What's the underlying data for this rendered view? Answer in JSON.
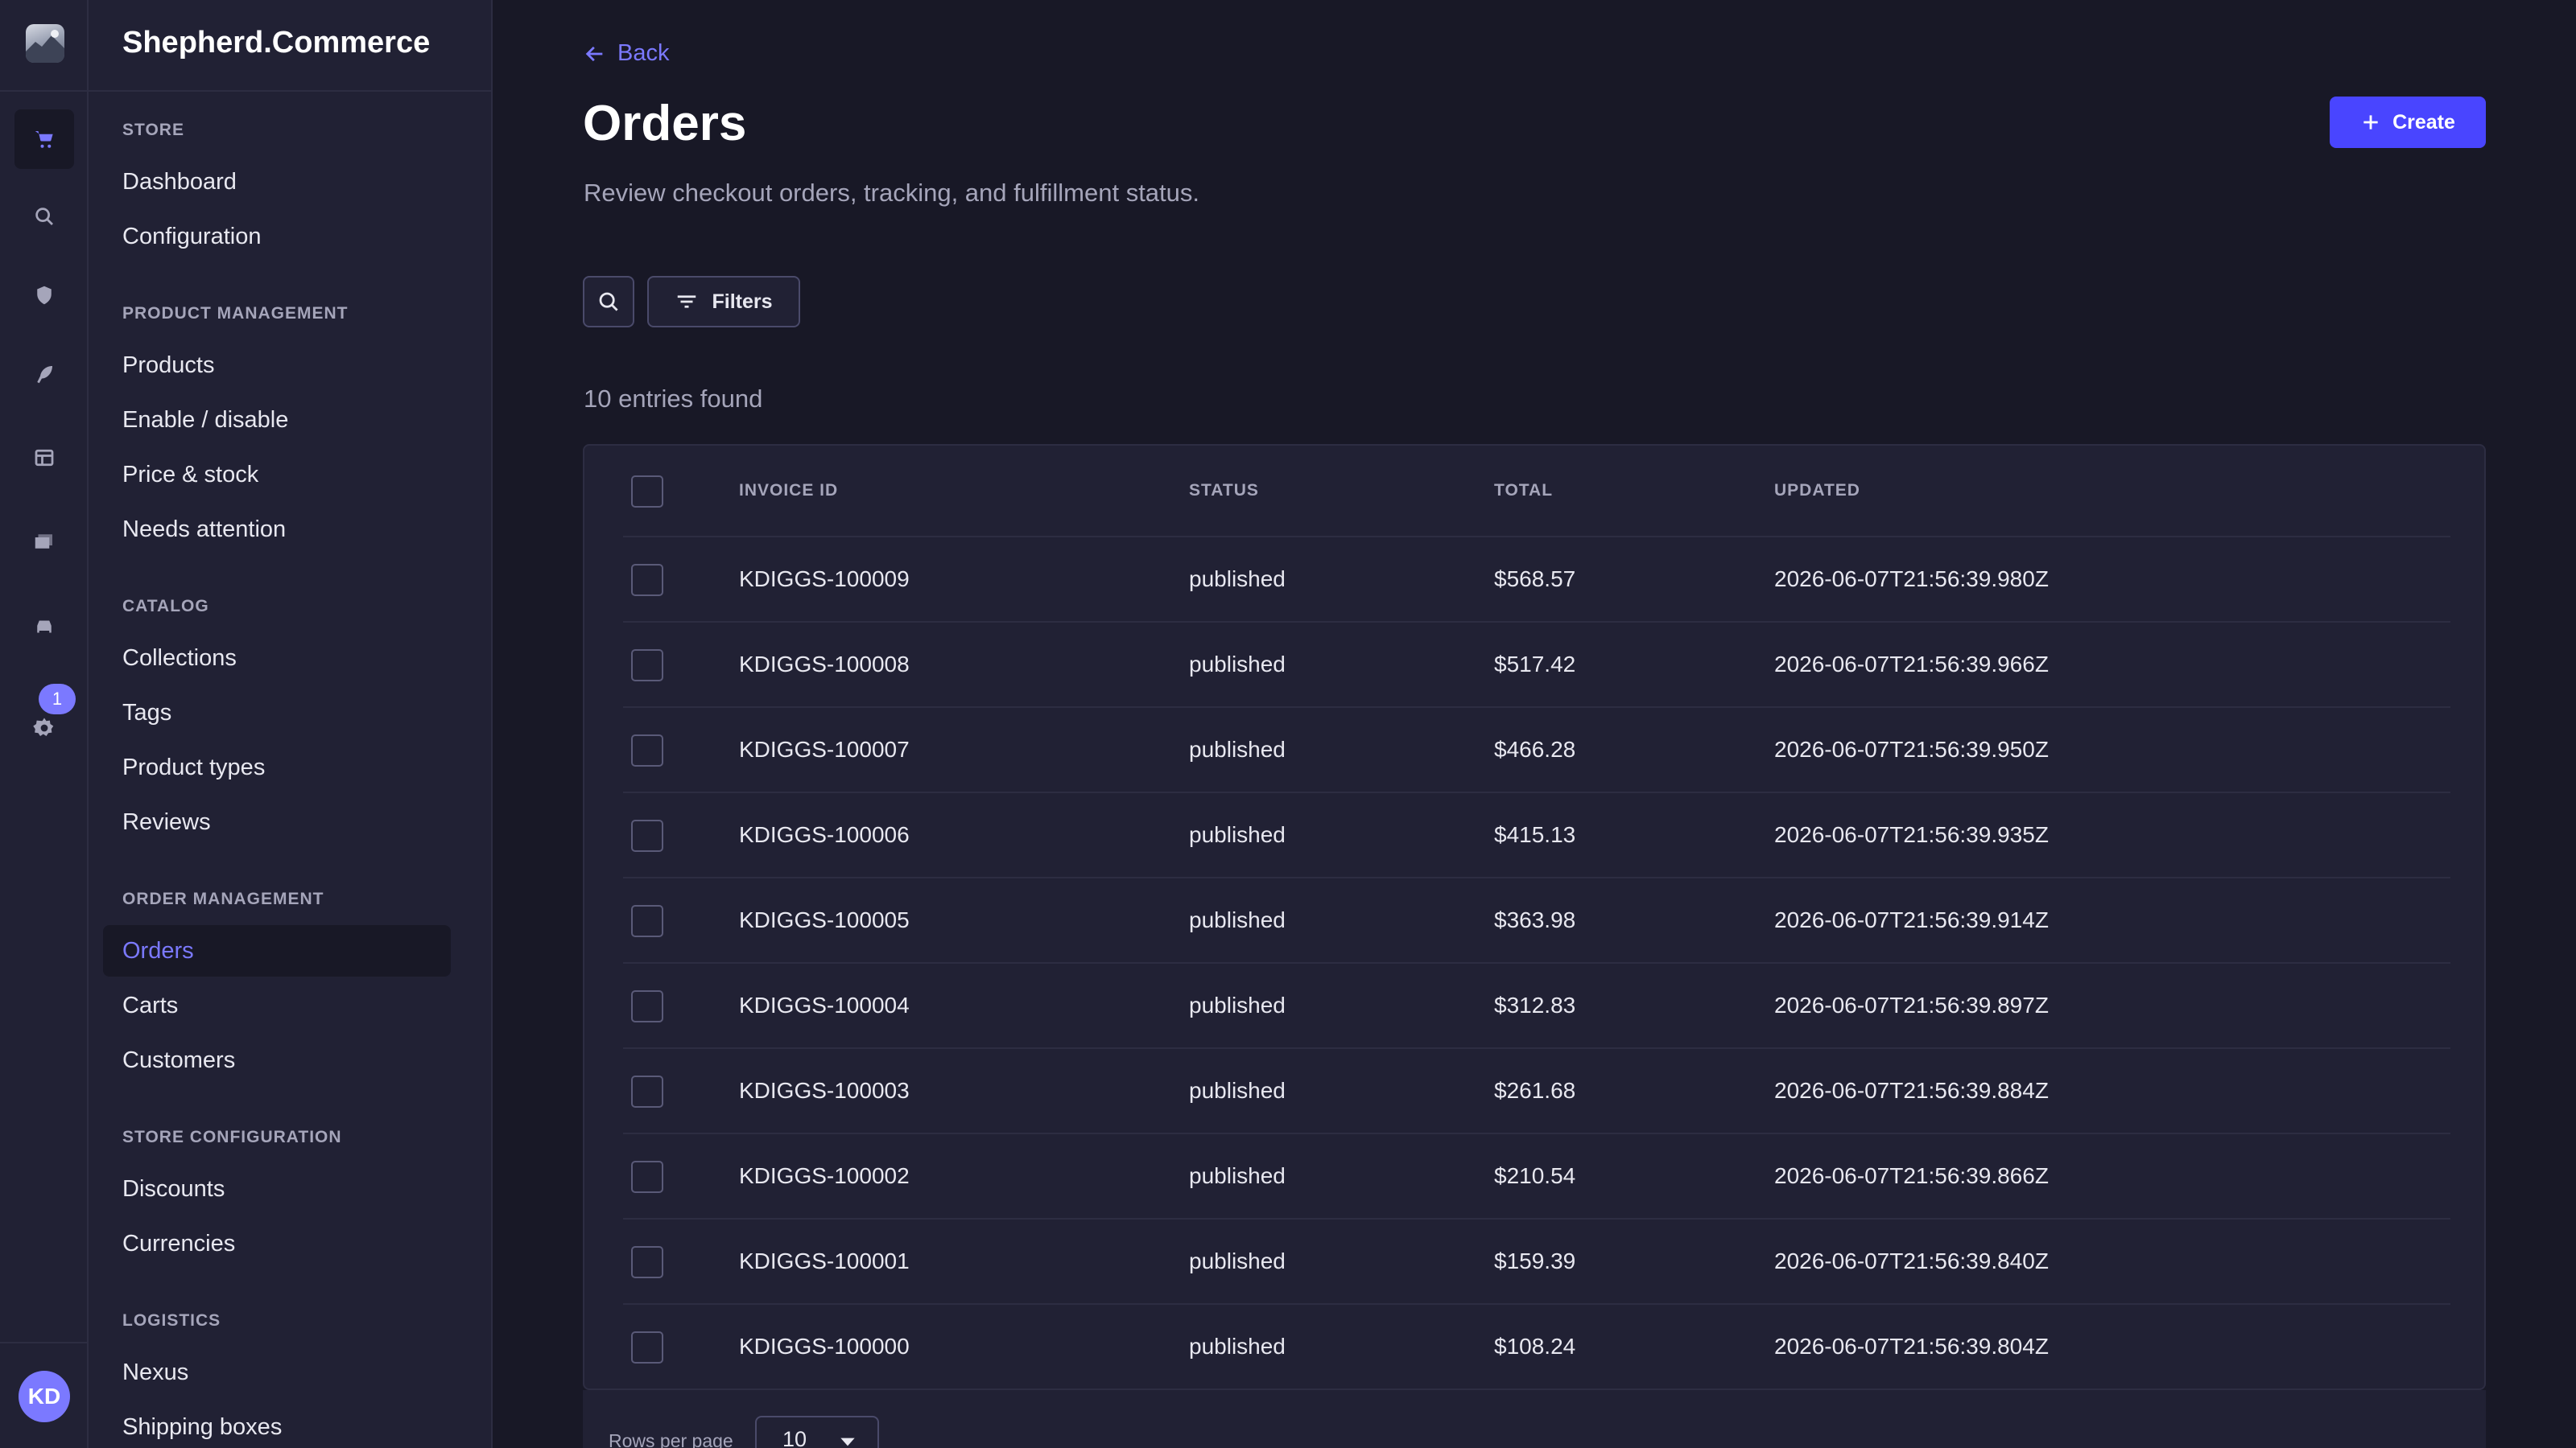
{
  "app": {
    "brand": "Shepherd.Commerce",
    "user_initials": "KD",
    "notification_count": "1",
    "accent_color": "#7b79ff",
    "primary_color": "#4945ff"
  },
  "rail": {
    "icons": [
      "shop-logo",
      "cart-icon",
      "search-icon",
      "shield-icon",
      "feather-icon",
      "layout-icon",
      "images-icon",
      "car-icon",
      "gear-icon"
    ]
  },
  "sidebar": {
    "sections": [
      {
        "title": "STORE",
        "items": [
          "Dashboard",
          "Configuration"
        ]
      },
      {
        "title": "PRODUCT MANAGEMENT",
        "items": [
          "Products",
          "Enable / disable",
          "Price & stock",
          "Needs attention"
        ]
      },
      {
        "title": "CATALOG",
        "items": [
          "Collections",
          "Tags",
          "Product types",
          "Reviews"
        ]
      },
      {
        "title": "ORDER MANAGEMENT",
        "items": [
          "Orders",
          "Carts",
          "Customers"
        ]
      },
      {
        "title": "STORE CONFIGURATION",
        "items": [
          "Discounts",
          "Currencies"
        ]
      },
      {
        "title": "LOGISTICS",
        "items": [
          "Nexus",
          "Shipping boxes"
        ]
      }
    ],
    "active_item": "Orders"
  },
  "page": {
    "back_label": "Back",
    "title": "Orders",
    "subtitle": "Review checkout orders, tracking, and fulfillment status.",
    "create_label": "Create",
    "filters_label": "Filters",
    "entries_text": "10 entries found"
  },
  "table": {
    "columns": [
      "INVOICE ID",
      "STATUS",
      "TOTAL",
      "UPDATED"
    ],
    "rows": [
      {
        "invoice": "KDIGGS-100009",
        "status": "published",
        "total": "$568.57",
        "updated": "2026-06-07T21:56:39.980Z"
      },
      {
        "invoice": "KDIGGS-100008",
        "status": "published",
        "total": "$517.42",
        "updated": "2026-06-07T21:56:39.966Z"
      },
      {
        "invoice": "KDIGGS-100007",
        "status": "published",
        "total": "$466.28",
        "updated": "2026-06-07T21:56:39.950Z"
      },
      {
        "invoice": "KDIGGS-100006",
        "status": "published",
        "total": "$415.13",
        "updated": "2026-06-07T21:56:39.935Z"
      },
      {
        "invoice": "KDIGGS-100005",
        "status": "published",
        "total": "$363.98",
        "updated": "2026-06-07T21:56:39.914Z"
      },
      {
        "invoice": "KDIGGS-100004",
        "status": "published",
        "total": "$312.83",
        "updated": "2026-06-07T21:56:39.897Z"
      },
      {
        "invoice": "KDIGGS-100003",
        "status": "published",
        "total": "$261.68",
        "updated": "2026-06-07T21:56:39.884Z"
      },
      {
        "invoice": "KDIGGS-100002",
        "status": "published",
        "total": "$210.54",
        "updated": "2026-06-07T21:56:39.866Z"
      },
      {
        "invoice": "KDIGGS-100001",
        "status": "published",
        "total": "$159.39",
        "updated": "2026-06-07T21:56:39.840Z"
      },
      {
        "invoice": "KDIGGS-100000",
        "status": "published",
        "total": "$108.24",
        "updated": "2026-06-07T21:56:39.804Z"
      }
    ]
  },
  "pagination": {
    "rows_per_page_label": "Rows per page",
    "rows_per_page_value": "10"
  }
}
